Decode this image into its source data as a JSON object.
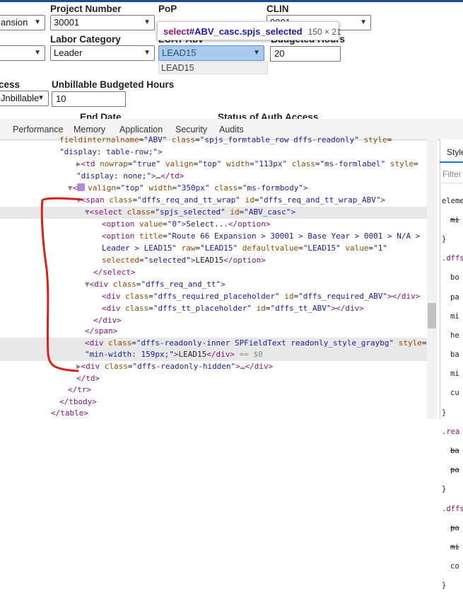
{
  "form": {
    "row1": {
      "expansion_value": "ansion",
      "project_number_label": "Project Number",
      "project_number_value": "30001",
      "pop_label": "PoP",
      "clin_label": "CLIN",
      "clin_value": "0001"
    },
    "row2": {
      "labor_category_label": "Labor Category",
      "labor_category_value": "Leader",
      "lcat_abv_label": "LCAT Abv",
      "lcat_abv_value": "LEAD15",
      "dropdown_option": "LEAD15",
      "budgeted_hours_label": "Budgeted Hours",
      "budgeted_hours_value": "20"
    },
    "row3": {
      "access_label": "cess",
      "access_value": "Jnbillable",
      "unbillable_label": "Unbillable Budgeted Hours",
      "unbillable_value": "10",
      "end_date_label": "End Date",
      "status_label": "Status of Auth Access"
    }
  },
  "tooltip": {
    "tag": "select",
    "selector": "#ABV_casc.spjs_selected",
    "size": "150 × 21"
  },
  "devtools": {
    "tabs": [
      "Performance",
      "Memory",
      "Application",
      "Security",
      "Audits"
    ],
    "styles_tab": "Style",
    "filter_placeholder": "Filter",
    "elements_lines": [
      "fieldinternalname=\"ABV\" class=\"spjs_formtable_row dffs-readonly\" style=",
      "\"display: table-row;\">",
      "<td nowrap=\"true\" valign=\"top\" width=\"113px\" class=\"ms-formlabel\" style=",
      "\"display: none;\">…</td>",
      "<td valign=\"top\" width=\"350px\" class=\"ms-formbody\">",
      "<span class=\"dffs_req_and_tt_wrap\" id=\"dffs_req_and_tt_wrap_ABV\">",
      "<select class=\"spjs_selected\" id=\"ABV_casc\">",
      "<option value=\"0\">Select...</option>",
      "<option title=\"Route 66 Expansion > 30001 > Base Year > 0001 > N/A >",
      "Leader > LEAD15\" raw=\"LEAD15\" defaultvalue=\"LEAD15\" value=\"1\"",
      "selected=\"selected\">LEAD15</option>",
      "</select>",
      "<div class=\"dffs_req_and_tt\">",
      "<div class=\"dffs_required_placeholder\" id=\"dffs_required_ABV\"></div>",
      "<div class=\"dffs_tt_placeholder\" id=\"dffs_tt_ABV\"></div>",
      "</div>",
      "</span>",
      "<div class=\"dffs-readonly-inner SPFieldText readonly_style_graybg\" style=",
      "\"min-width: 159px;\">LEAD15</div>",
      "== $0",
      "<div class=\"dffs-readonly-hidden\">…</div>",
      "</td>",
      "</tr>",
      "</tbody>",
      "</table>"
    ],
    "styles_lines": [
      "eleme",
      "mi",
      "}",
      ".dffs",
      "bo",
      "pa",
      "mi",
      "he",
      "ba",
      "mi",
      "cu",
      "}",
      ".rea",
      "ba",
      "pa",
      "}",
      ".dffs",
      "pa",
      "mi",
      "co",
      "}"
    ]
  },
  "colors": {
    "tag": "#881280",
    "attr_name": "#994500",
    "attr_value": "#1a1aa6",
    "annotation_red": "#d9211a",
    "selected_option_bg": "#a9c9ef"
  }
}
